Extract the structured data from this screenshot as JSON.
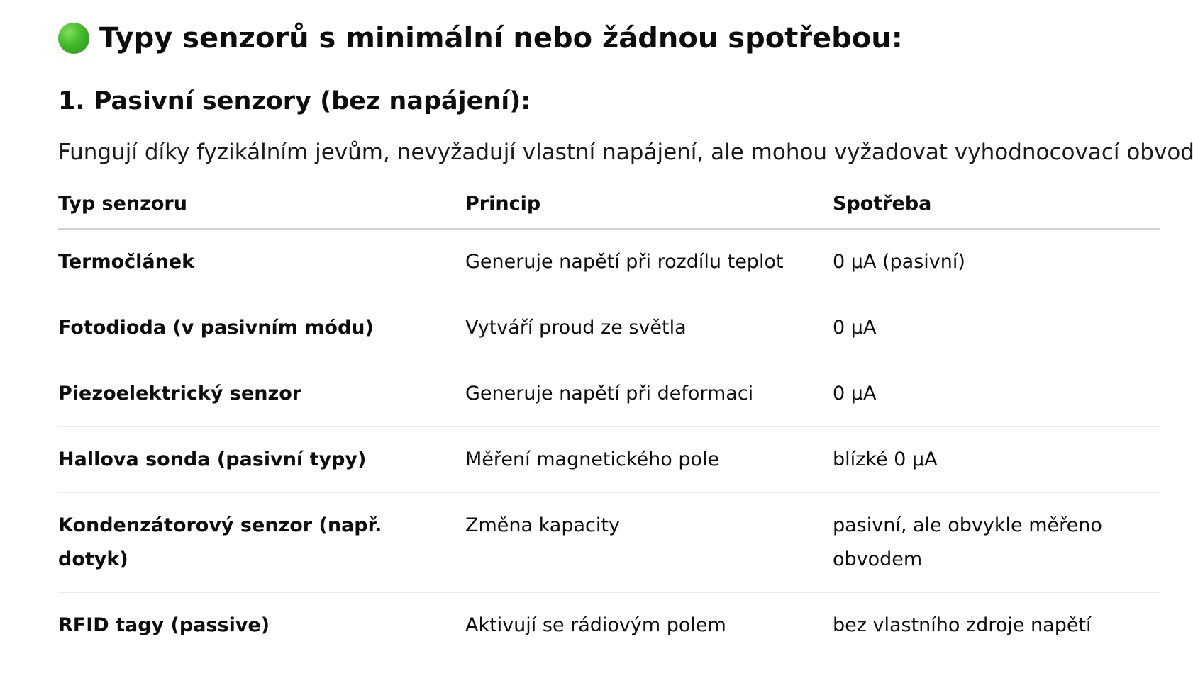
{
  "heading": {
    "icon": "green-circle-icon",
    "icon_color": "#43b82a",
    "text": "Typy senzorů s minimální nebo žádnou spotřebou:"
  },
  "section": {
    "title": "1. Pasivní senzory (bez napájení):",
    "description": "Fungují díky fyzikálním jevům, nevyžadují vlastní napájení, ale mohou vyžadovat vyhodnocovací obvod."
  },
  "table": {
    "headers": [
      "Typ senzoru",
      "Princip",
      "Spotřeba"
    ],
    "rows": [
      [
        "Termočlánek",
        "Generuje napětí při rozdílu teplot",
        "0 µA (pasivní)"
      ],
      [
        "Fotodioda (v pasivním módu)",
        "Vytváří proud ze světla",
        "0 µA"
      ],
      [
        "Piezoelektrický senzor",
        "Generuje napětí při deformaci",
        "0 µA"
      ],
      [
        "Hallova sonda (pasivní typy)",
        "Měření magnetického pole",
        "blízké 0 µA"
      ],
      [
        "Kondenzátorový senzor (např. dotyk)",
        "Změna kapacity",
        "pasivní, ale obvykle měřeno obvodem"
      ],
      [
        "RFID tagy (passive)",
        "Aktivují se rádiovým polem",
        "bez vlastního zdroje napětí"
      ]
    ]
  }
}
